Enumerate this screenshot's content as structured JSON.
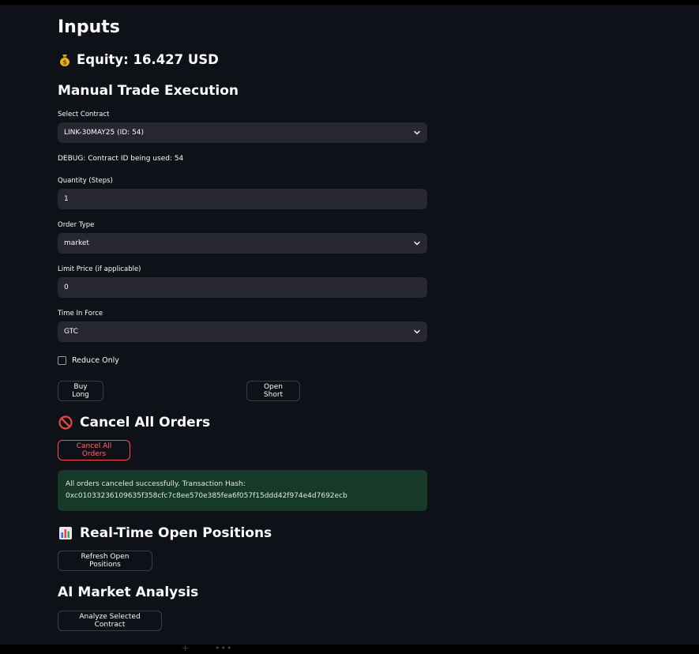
{
  "page": {
    "title": "Inputs",
    "equity_label": "Equity: 16.427 USD"
  },
  "manual_trade": {
    "heading": "Manual Trade Execution",
    "contract_label": "Select Contract",
    "contract_value": "LINK-30MAY25 (ID: 54)",
    "debug_text": "DEBUG: Contract ID being used: 54",
    "quantity_label": "Quantity (Steps)",
    "quantity_value": "1",
    "order_type_label": "Order Type",
    "order_type_value": "market",
    "limit_price_label": "Limit Price (if applicable)",
    "limit_price_value": "0",
    "tif_label": "Time In Force",
    "tif_value": "GTC",
    "reduce_only_label": "Reduce Only",
    "reduce_only_checked": false,
    "buy_long_label": "Buy Long",
    "open_short_label": "Open Short"
  },
  "cancel": {
    "heading": "Cancel All Orders",
    "button_label": "Cancel All Orders",
    "success_line1": "All orders canceled successfully. Transaction Hash:",
    "success_line2": "0xc01033236109635f358cfc7c8ee570e385fea6f057f15ddd42f974e4d7692ecb"
  },
  "positions": {
    "heading": "Real-Time Open Positions",
    "refresh_label": "Refresh Open Positions"
  },
  "ai": {
    "heading": "AI Market Analysis",
    "analyze_label": "Analyze Selected Contract"
  },
  "icons": {
    "equity": "money-bag-icon",
    "cancel": "no-entry-icon",
    "positions": "bar-chart-icon",
    "dropdown": "chevron-down-icon"
  },
  "colors": {
    "background": "#0e1117",
    "input_bg": "#262730",
    "danger": "#ff4b4b",
    "success_bg": "#173928"
  }
}
